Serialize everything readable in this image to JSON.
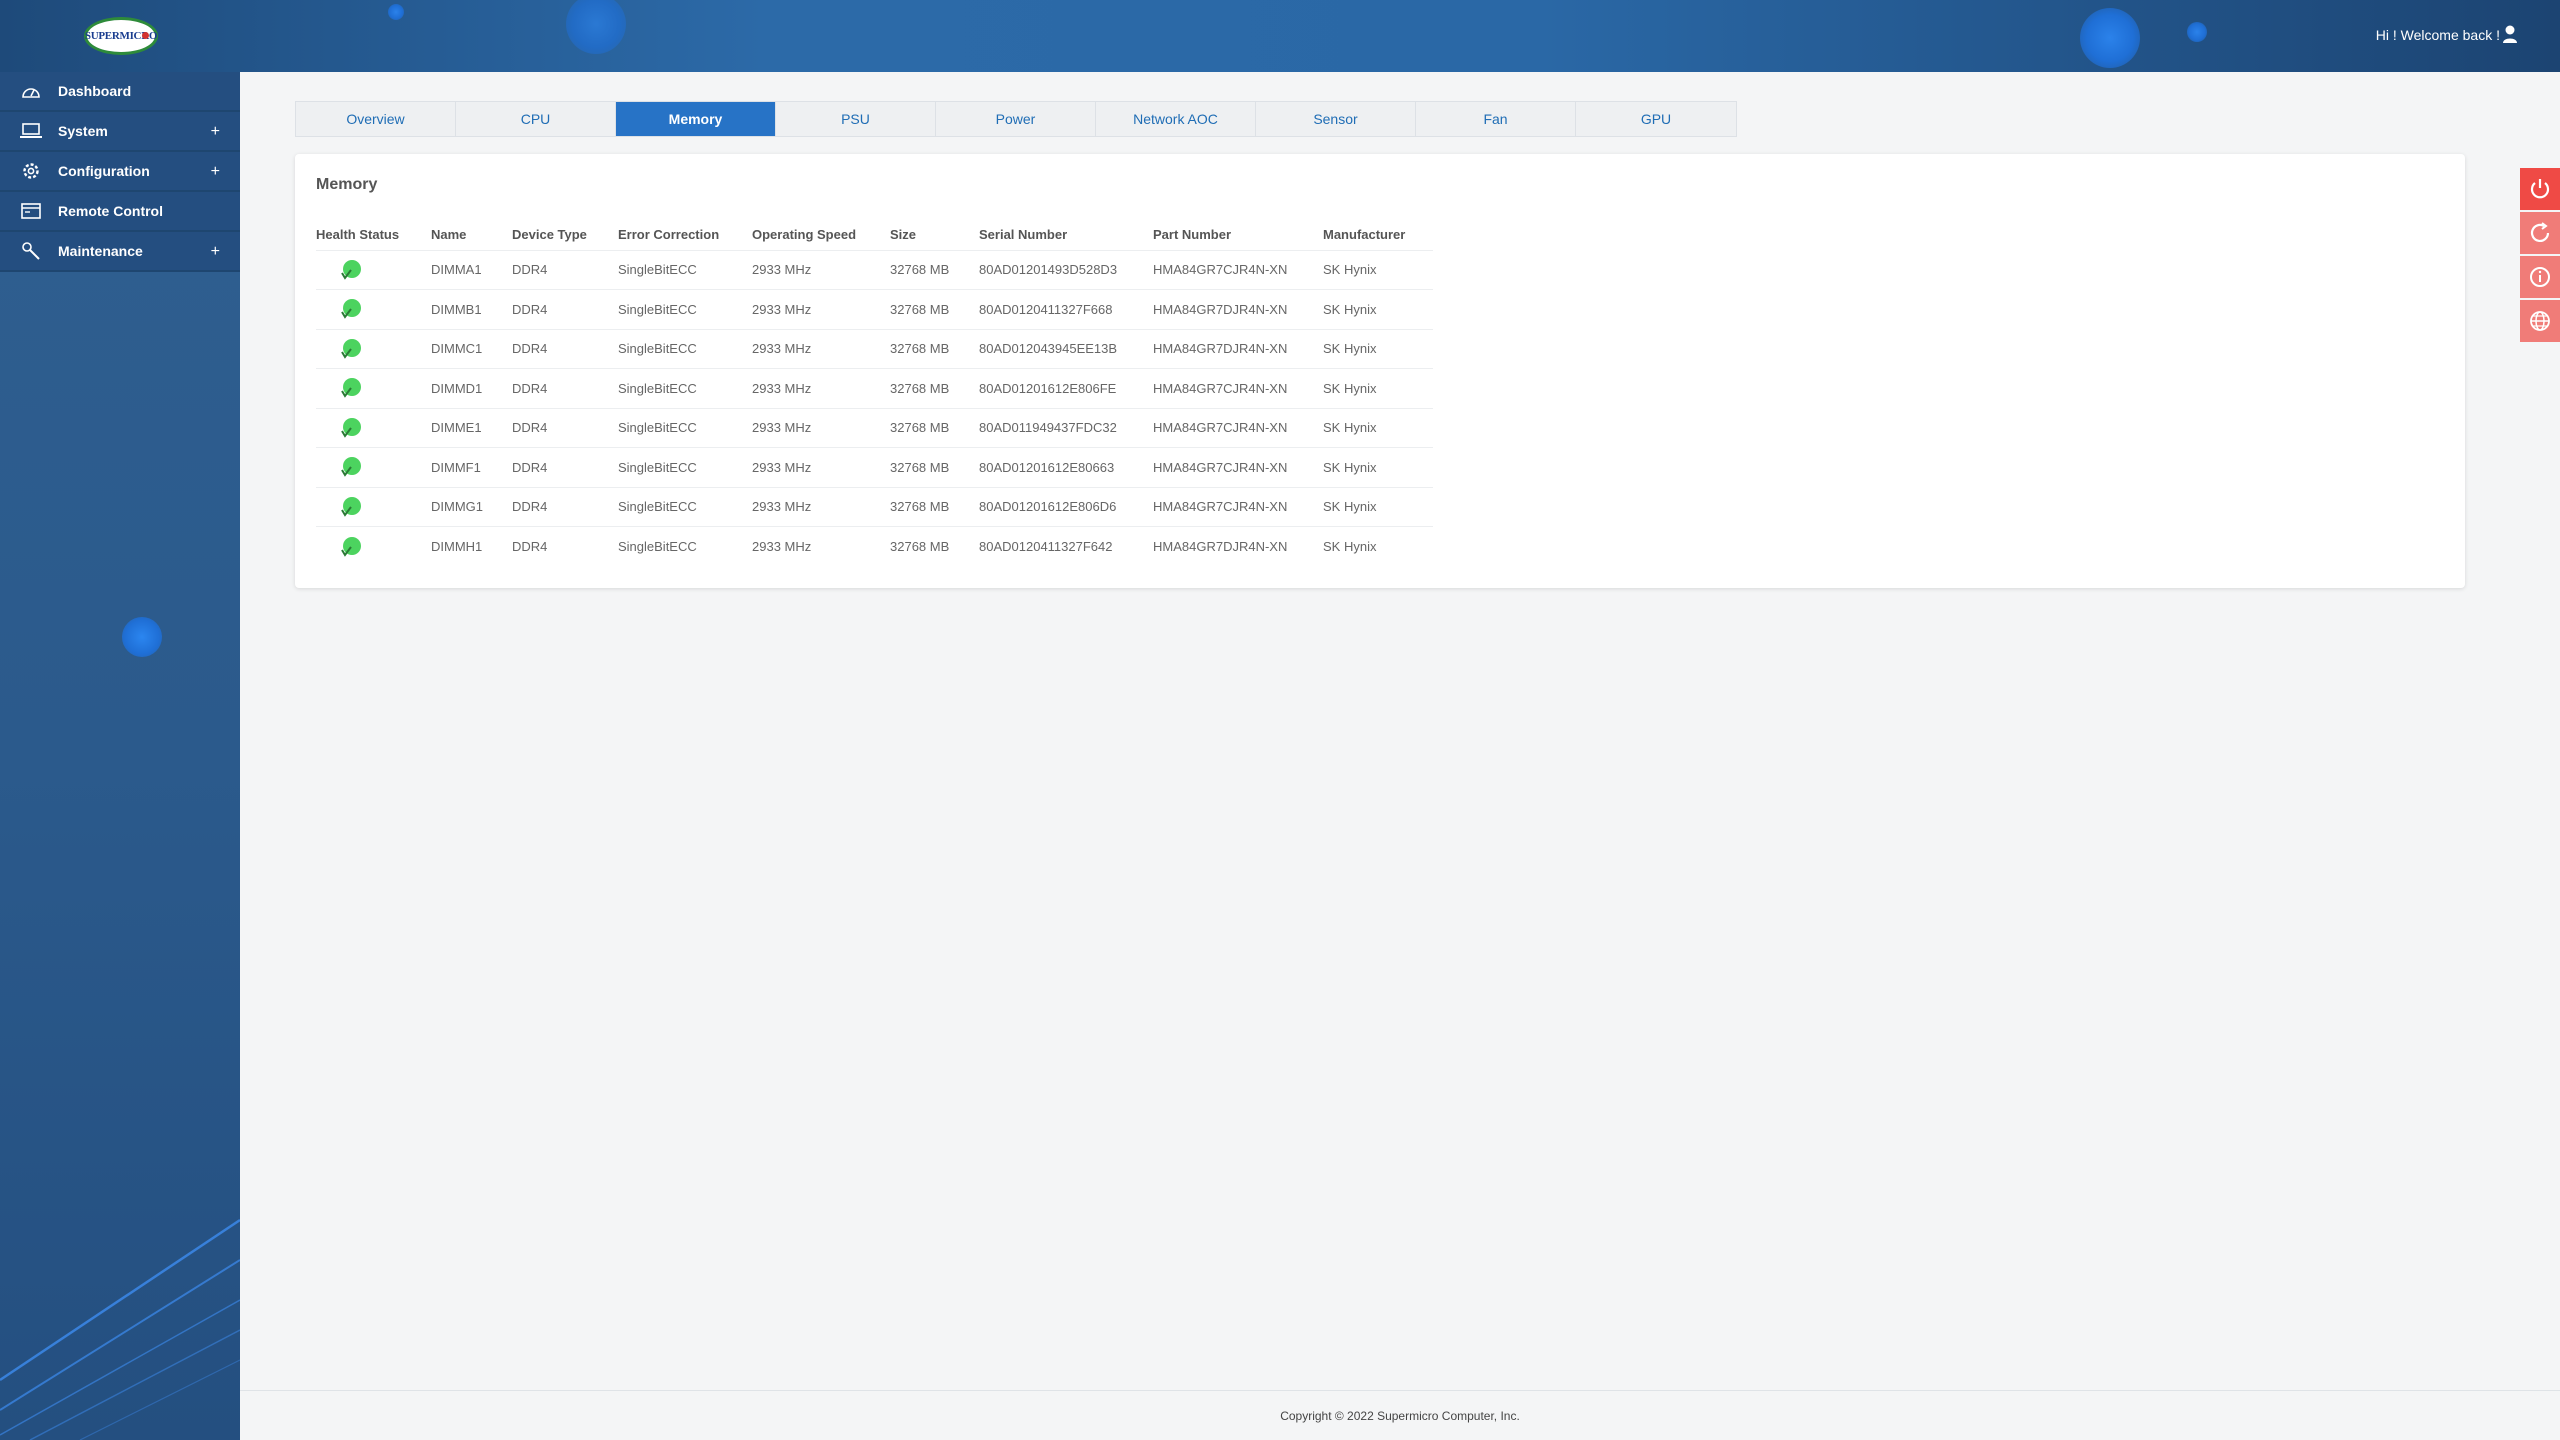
{
  "header": {
    "logo_text": "SUPERMICRO",
    "welcome": "Hi ! Welcome back !"
  },
  "sidebar": {
    "items": [
      {
        "label": "Dashboard",
        "icon": "dashboard-icon",
        "expandable": false
      },
      {
        "label": "System",
        "icon": "laptop-icon",
        "expandable": true
      },
      {
        "label": "Configuration",
        "icon": "gear-icon",
        "expandable": true
      },
      {
        "label": "Remote Control",
        "icon": "console-icon",
        "expandable": false
      },
      {
        "label": "Maintenance",
        "icon": "wrench-icon",
        "expandable": true
      }
    ],
    "expand_symbol": "+"
  },
  "tabs": [
    {
      "label": "Overview",
      "active": false
    },
    {
      "label": "CPU",
      "active": false
    },
    {
      "label": "Memory",
      "active": true
    },
    {
      "label": "PSU",
      "active": false
    },
    {
      "label": "Power",
      "active": false
    },
    {
      "label": "Network AOC",
      "active": false
    },
    {
      "label": "Sensor",
      "active": false
    },
    {
      "label": "Fan",
      "active": false
    },
    {
      "label": "GPU",
      "active": false
    }
  ],
  "memory": {
    "title": "Memory",
    "columns": [
      "Health Status",
      "Name",
      "Device Type",
      "Error Correction",
      "Operating Speed",
      "Size",
      "Serial Number",
      "Part Number",
      "Manufacturer"
    ],
    "rows": [
      {
        "name": "DIMMA1",
        "type": "DDR4",
        "ecc": "SingleBitECC",
        "speed": "2933 MHz",
        "size": "32768 MB",
        "serial": "80AD01201493D528D3",
        "part": "HMA84GR7CJR4N-XN",
        "mfr": "SK Hynix"
      },
      {
        "name": "DIMMB1",
        "type": "DDR4",
        "ecc": "SingleBitECC",
        "speed": "2933 MHz",
        "size": "32768 MB",
        "serial": "80AD0120411327F668",
        "part": "HMA84GR7DJR4N-XN",
        "mfr": "SK Hynix"
      },
      {
        "name": "DIMMC1",
        "type": "DDR4",
        "ecc": "SingleBitECC",
        "speed": "2933 MHz",
        "size": "32768 MB",
        "serial": "80AD012043945EE13B",
        "part": "HMA84GR7DJR4N-XN",
        "mfr": "SK Hynix"
      },
      {
        "name": "DIMMD1",
        "type": "DDR4",
        "ecc": "SingleBitECC",
        "speed": "2933 MHz",
        "size": "32768 MB",
        "serial": "80AD01201612E806FE",
        "part": "HMA84GR7CJR4N-XN",
        "mfr": "SK Hynix"
      },
      {
        "name": "DIMME1",
        "type": "DDR4",
        "ecc": "SingleBitECC",
        "speed": "2933 MHz",
        "size": "32768 MB",
        "serial": "80AD011949437FDC32",
        "part": "HMA84GR7CJR4N-XN",
        "mfr": "SK Hynix"
      },
      {
        "name": "DIMMF1",
        "type": "DDR4",
        "ecc": "SingleBitECC",
        "speed": "2933 MHz",
        "size": "32768 MB",
        "serial": "80AD01201612E80663",
        "part": "HMA84GR7CJR4N-XN",
        "mfr": "SK Hynix"
      },
      {
        "name": "DIMMG1",
        "type": "DDR4",
        "ecc": "SingleBitECC",
        "speed": "2933 MHz",
        "size": "32768 MB",
        "serial": "80AD01201612E806D6",
        "part": "HMA84GR7CJR4N-XN",
        "mfr": "SK Hynix"
      },
      {
        "name": "DIMMH1",
        "type": "DDR4",
        "ecc": "SingleBitECC",
        "speed": "2933 MHz",
        "size": "32768 MB",
        "serial": "80AD0120411327F642",
        "part": "HMA84GR7DJR4N-XN",
        "mfr": "SK Hynix"
      }
    ],
    "health_icon": "health-ok-icon"
  },
  "actions": [
    {
      "icon": "power-icon",
      "color": "#ef4a45"
    },
    {
      "icon": "refresh-icon",
      "color": "#f07c78"
    },
    {
      "icon": "info-icon",
      "color": "#f07c78"
    },
    {
      "icon": "globe-icon",
      "color": "#f07c78"
    }
  ],
  "footer": {
    "copyright": "Copyright © 2022 Supermicro Computer, Inc."
  },
  "colors": {
    "accent": "#2773c6",
    "header": "#2c6aa8",
    "sidebar": "#244e80",
    "ok": "#4cd35f",
    "action_red": "#ef4a45"
  }
}
